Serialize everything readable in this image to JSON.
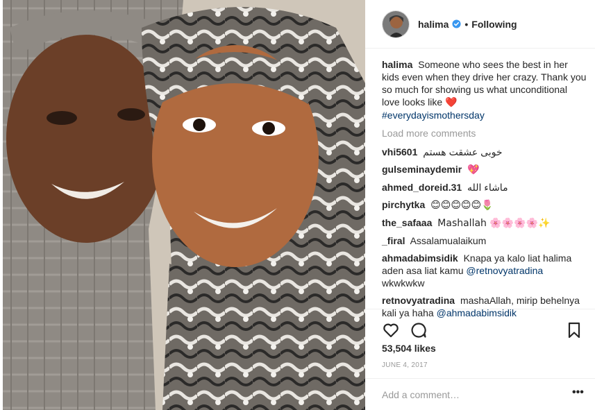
{
  "post": {
    "username": "halima",
    "header_separator": "•",
    "follow_status": "Following",
    "caption_text": "Someone who sees the best in her kids even when they drive her crazy. Thank you so much for showing us what unconditional love looks like",
    "caption_emoji": "❤️",
    "caption_hashtag": "#everydayismothersday",
    "load_more": "Load more comments",
    "comments": [
      {
        "user": "vhi5601",
        "text": "خوبی عشقت هستم"
      },
      {
        "user": "gulseminaydemir",
        "text": "💖"
      },
      {
        "user": "ahmed_doreid.31",
        "text": "ماشاء الله"
      },
      {
        "user": "pirchytka",
        "text": "😊😊😊😊😊🌷"
      },
      {
        "user": "the_safaaa",
        "text": "Mashallah 🌸🌸🌸🌸✨"
      },
      {
        "user": "_firal",
        "text": "Assalamualaikum"
      },
      {
        "user": "ahmadabimsidik",
        "text": "Knapa ya kalo liat halima aden asa liat kamu",
        "mention": "@retnovyatradina",
        "text_after": " wkwkwkw"
      },
      {
        "user": "retnovyatradina",
        "text": "mashaAllah, mirip behelnya kali ya haha",
        "mention": "@ahmadabimsidik",
        "text_after": ""
      }
    ],
    "likes": "53,504 likes",
    "date": "JUNE 4, 2017",
    "add_comment_placeholder": "Add a comment…",
    "more_label": "•••",
    "colors": {
      "verified": "#3897f0",
      "link": "#003569",
      "muted": "#999999",
      "heart": "#ed4956"
    },
    "icons": {
      "like": "heart-outline-icon",
      "comment": "speech-bubble-icon",
      "save": "bookmark-icon",
      "verified": "verified-badge-icon"
    }
  }
}
